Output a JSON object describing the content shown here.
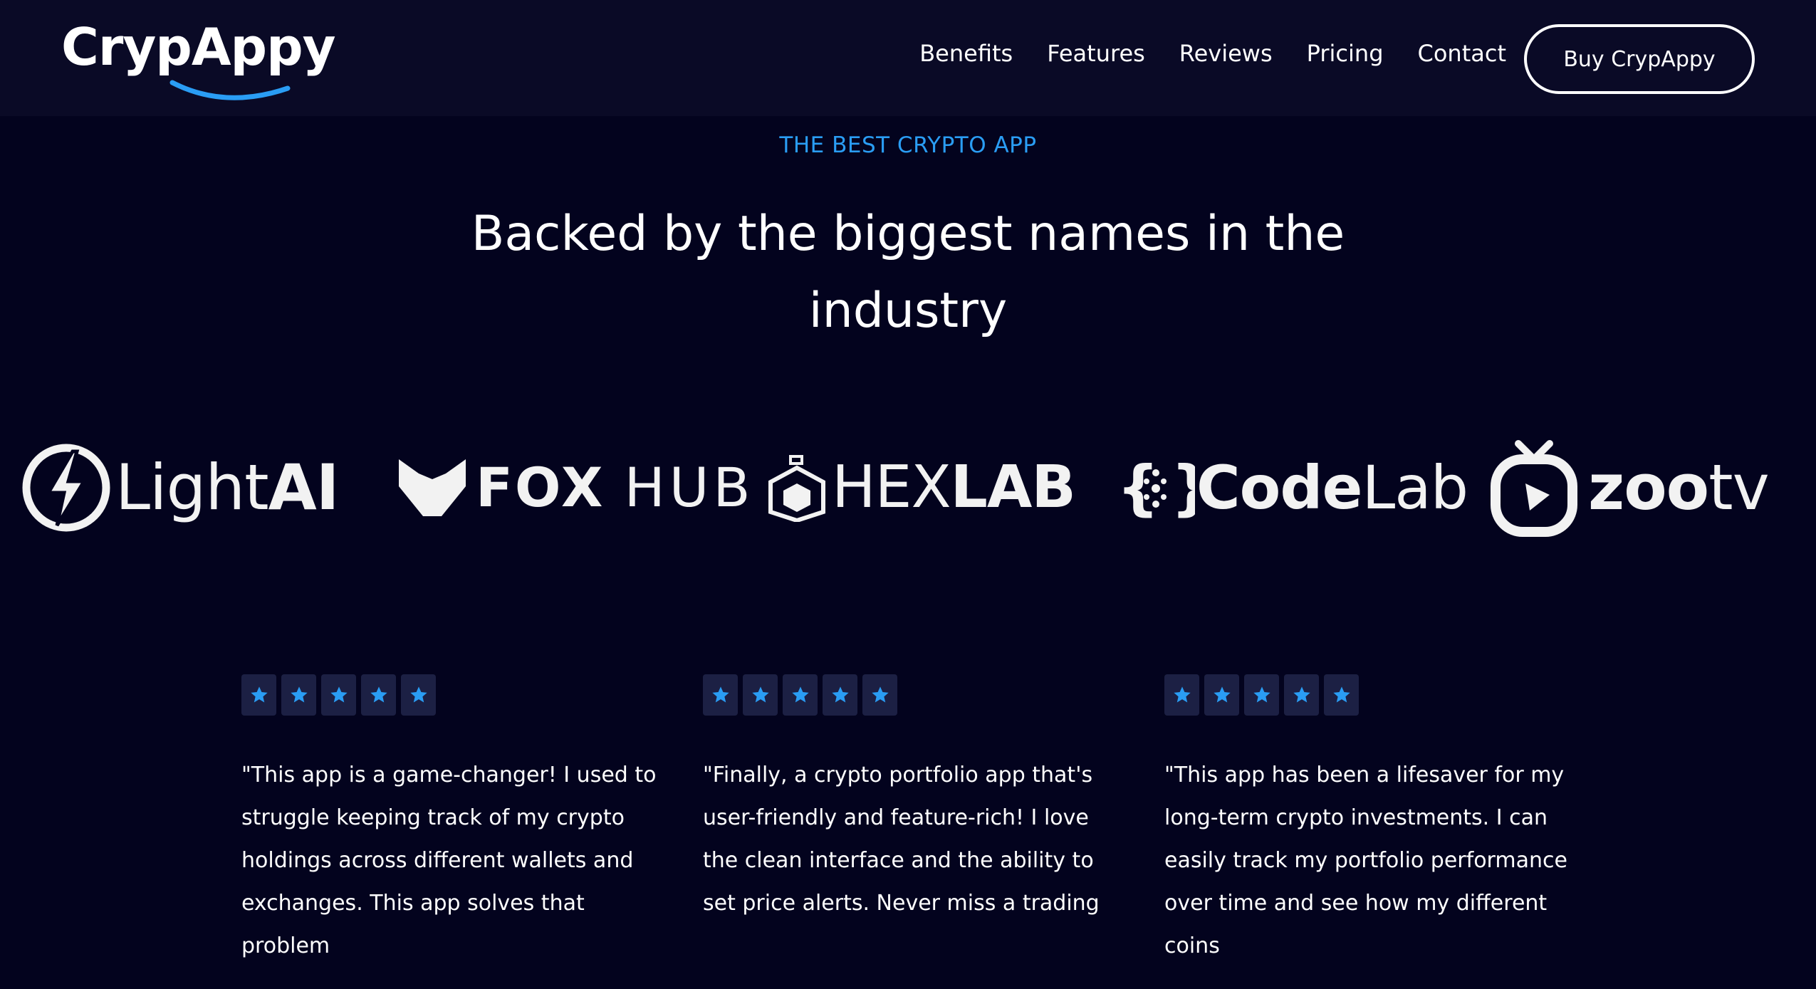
{
  "brand": {
    "name": "CrypAppy"
  },
  "nav": {
    "items": [
      {
        "label": "Benefits"
      },
      {
        "label": "Features"
      },
      {
        "label": "Reviews"
      },
      {
        "label": "Pricing"
      },
      {
        "label": "Contact"
      }
    ],
    "cta_label": "Buy CrypAppy"
  },
  "hero": {
    "eyebrow": "THE BEST CRYPTO APP",
    "headline": "Backed by the biggest names in the industry"
  },
  "partners": [
    {
      "name": "LightAI",
      "icon": "lightning-bolt-icon"
    },
    {
      "name": "FOXHUB",
      "icon": "fox-head-icon"
    },
    {
      "name": "HEXLAB",
      "icon": "flask-hexagon-icon"
    },
    {
      "name": "CodeLab",
      "icon": "braces-dots-icon"
    },
    {
      "name": "zootv",
      "icon": "tv-play-icon"
    }
  ],
  "reviews": [
    {
      "rating": 5,
      "text": "\"This app is a game-changer! I used to struggle keeping track of my crypto holdings across different wallets and exchanges. This app solves that problem"
    },
    {
      "rating": 5,
      "text": "\"Finally, a crypto portfolio app that's user-friendly and feature-rich! I love the clean interface and the ability to set price alerts. Never miss a trading"
    },
    {
      "rating": 5,
      "text": "\"This app has been a lifesaver for my long-term crypto investments. I can easily track my portfolio performance over time and see how my different coins"
    }
  ],
  "colors": {
    "background": "#03031e",
    "header": "#0a0a26",
    "accent": "#2a9df4",
    "star_box": "#1c2044"
  }
}
